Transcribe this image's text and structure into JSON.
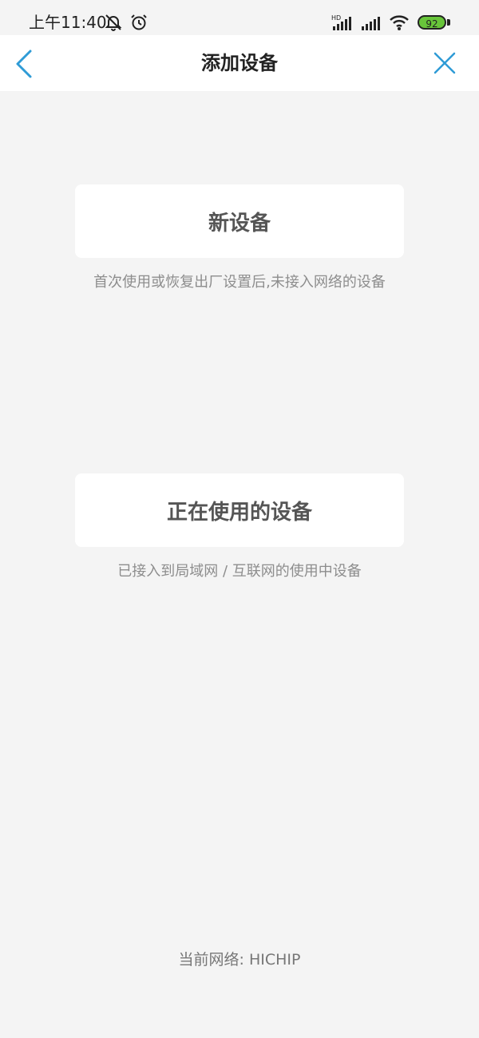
{
  "status_bar": {
    "time": "上午11:40",
    "left_icons": [
      "mute-icon",
      "alarm-icon"
    ],
    "right_icons": [
      "hd-signal-icon",
      "signal-icon",
      "wifi-icon",
      "battery-icon"
    ],
    "battery_level": "92",
    "battery_color": "#68c53a"
  },
  "header": {
    "title": "添加设备",
    "accent_color": "#2f9bd6"
  },
  "options": [
    {
      "label": "新设备",
      "description": "首次使用或恢复出厂设置后,未接入网络的设备"
    },
    {
      "label": "正在使用的设备",
      "description": "已接入到局域网 / 互联网的使用中设备"
    }
  ],
  "footer": {
    "network_label": "当前网络: HICHIP"
  }
}
